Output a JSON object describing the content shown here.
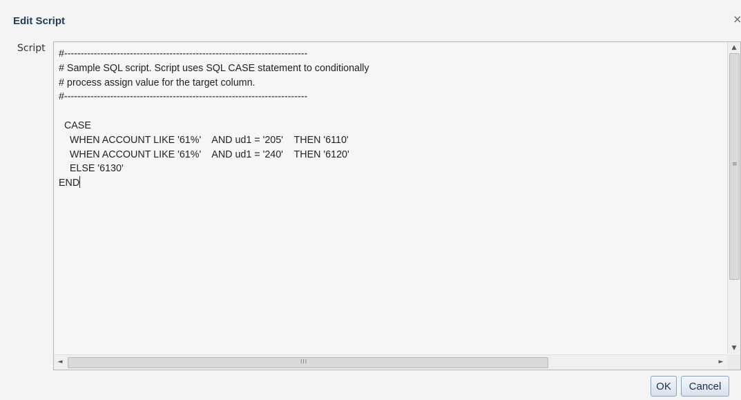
{
  "dialog": {
    "title": "Edit Script",
    "close_symbol": "×",
    "script_label": "Script",
    "script": {
      "lines": [
        "#--------------------------------------------------------------------------",
        "# Sample SQL script. Script uses SQL CASE statement to conditionally",
        "# process assign value for the target column.",
        "#--------------------------------------------------------------------------",
        "",
        "  CASE",
        "    WHEN ACCOUNT LIKE '61%'    AND ud1 = '205'    THEN '6110'",
        "    WHEN ACCOUNT LIKE '61%'    AND ud1 = '240'    THEN '6120'",
        "    ELSE '6130'",
        "END"
      ]
    },
    "scrollbar": {
      "up_arrow": "▲",
      "down_arrow": "▼",
      "left_arrow": "◄",
      "right_arrow": "►",
      "v_grip": "≡",
      "h_grip": "III"
    },
    "buttons": {
      "ok_label": "OK",
      "cancel_label": "Cancel"
    }
  }
}
